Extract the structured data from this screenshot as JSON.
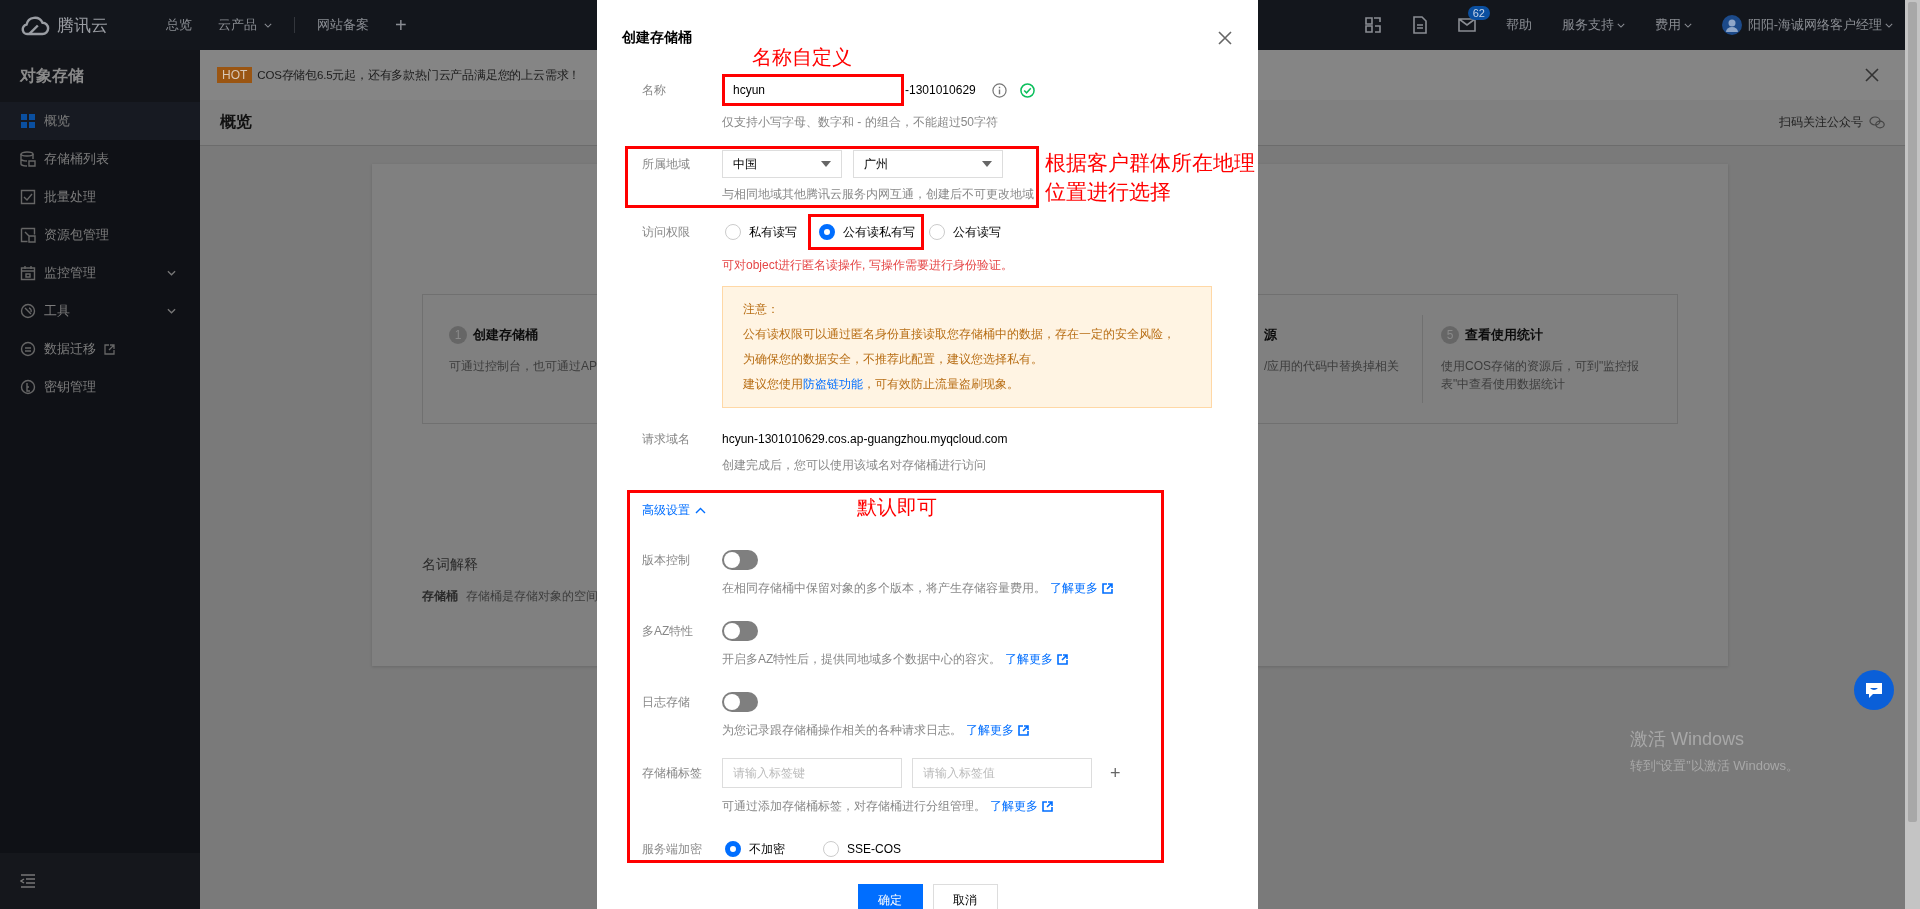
{
  "topbar": {
    "brand": "腾讯云",
    "nav": [
      {
        "label": "总览",
        "dropdown": false
      },
      {
        "label": "云产品",
        "dropdown": true
      },
      {
        "label": "网站备案",
        "dropdown": false
      }
    ],
    "add": "+",
    "mail_badge": "62",
    "links": [
      {
        "label": "帮助",
        "dropdown": false
      },
      {
        "label": "服务支持",
        "dropdown": true
      },
      {
        "label": "费用",
        "dropdown": true
      }
    ],
    "user": "阳阳-海诚网络客户经理"
  },
  "sidebar": {
    "title": "对象存储",
    "items": [
      {
        "label": "概览",
        "selected": true,
        "expandable": false,
        "external": false
      },
      {
        "label": "存储桶列表",
        "selected": false,
        "expandable": false,
        "external": false
      },
      {
        "label": "批量处理",
        "selected": false,
        "expandable": false,
        "external": false
      },
      {
        "label": "资源包管理",
        "selected": false,
        "expandable": false,
        "external": false
      },
      {
        "label": "监控管理",
        "selected": false,
        "expandable": true,
        "external": false
      },
      {
        "label": "工具",
        "selected": false,
        "expandable": true,
        "external": false
      },
      {
        "label": "数据迁移",
        "selected": false,
        "expandable": false,
        "external": true
      },
      {
        "label": "密钥管理",
        "selected": false,
        "expandable": false,
        "external": false
      }
    ]
  },
  "banner": {
    "tag": "HOT",
    "text": "COS存储包6.5元起，还有多款热门云产品满足您的上云需求！"
  },
  "page": {
    "title": "概览",
    "follow": "扫码关注公众号",
    "steps": [
      {
        "number": "1",
        "title": "创建存储桶",
        "text": "可通过控制台，也可通过AP"
      },
      {
        "title": "源",
        "text": "/应用的代码中替换掉相关"
      },
      {
        "number": "5",
        "title": "查看使用统计",
        "text": "使用COS存储的资源后，可到\"监控报表\"中查看使用数据统计"
      }
    ],
    "glossary_title": "名词解释",
    "glossary": [
      {
        "term": "存储桶",
        "text": "存储桶是存储对象的空间"
      }
    ]
  },
  "dialog": {
    "title": "创建存储桶",
    "name": {
      "label": "名称",
      "value": "hcyun",
      "suffix": "-1301010629",
      "valid": true,
      "hint": "仅支持小写字母、数字和 - 的组合，不能超过50字符",
      "highlighted": true,
      "annotation": "名称自定义"
    },
    "region": {
      "label": "所属地域",
      "selects": [
        "中国",
        "广州"
      ],
      "hint": "与相同地域其他腾讯云服务内网互通，创建后不可更改地域",
      "highlighted": true,
      "annotation": "根据客户群体所在地理位置进行选择"
    },
    "access": {
      "label": "访问权限",
      "options": [
        {
          "label": "私有读写",
          "selected": false,
          "highlighted": false
        },
        {
          "label": "公有读私有写",
          "selected": true,
          "highlighted": true
        },
        {
          "label": "公有读写",
          "selected": false,
          "highlighted": false
        }
      ],
      "warning": "可对object进行匿名读操作, 写操作需要进行身份验证。",
      "notice": {
        "title": "注意：",
        "lines": [
          "公有读权限可以通过匿名身份直接读取您存储桶中的数据，存在一定的安全风险，",
          "为确保您的数据安全，不推荐此配置，建议您选择私有。"
        ],
        "tip_before": "建议您使用",
        "tip_link": "防盗链功能",
        "tip_after": "，可有效防止流量盗刷现象。"
      }
    },
    "domain": {
      "label": "请求域名",
      "value": "hcyun-1301010629.cos.ap-guangzhou.myqcloud.com",
      "hint": "创建完成后，您可以使用该域名对存储桶进行访问"
    },
    "advanced": {
      "toggle": "高级设置",
      "expanded": true,
      "highlighted": true,
      "annotation": "默认即可",
      "switches": [
        {
          "label": "版本控制",
          "on": false,
          "hint": "在相同存储桶中保留对象的多个版本，将产生存储容量费用。",
          "link": "了解更多"
        },
        {
          "label": "多AZ特性",
          "on": false,
          "hint": "开启多AZ特性后，提供同地域多个数据中心的容灾。",
          "link": "了解更多"
        },
        {
          "label": "日志存储",
          "on": false,
          "hint": "为您记录跟存储桶操作相关的各种请求日志。",
          "link": "了解更多"
        }
      ],
      "tags": {
        "label": "存储桶标签",
        "key_placeholder": "请输入标签键",
        "value_placeholder": "请输入标签值",
        "add": "+",
        "hint": "可通过添加存储桶标签，对存储桶进行分组管理。",
        "link": "了解更多"
      },
      "encryption": {
        "label": "服务端加密",
        "options": [
          {
            "label": "不加密",
            "selected": true
          },
          {
            "label": "SSE-COS",
            "selected": false
          }
        ]
      }
    },
    "buttons": [
      {
        "label": "确定",
        "kind": "primary"
      },
      {
        "label": "取消",
        "kind": "default"
      }
    ]
  },
  "windows": {
    "title": "激活 Windows",
    "text": "转到“设置”以激活 Windows。"
  }
}
